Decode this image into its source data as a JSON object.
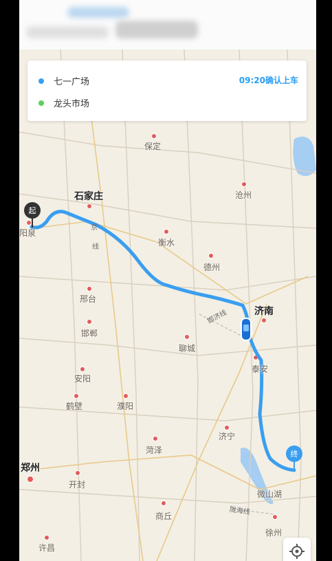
{
  "trip_card": {
    "origin": "七一广场",
    "destination": "龙头市场",
    "pickup_confirm": "09:20确认上车"
  },
  "markers": {
    "start": "起",
    "end": "终"
  },
  "cities": {
    "baoding": "保定",
    "shijiazhuang": "石家庄",
    "cangzhou": "沧州",
    "yangquan": "阳泉",
    "hengshui": "衡水",
    "dezhou": "德州",
    "xingtai": "邢台",
    "jinan": "济南",
    "handan": "邯郸",
    "liaocheng": "聊城",
    "taian": "泰安",
    "anyang": "安阳",
    "hebi": "鹤壁",
    "puyang": "濮阳",
    "jining": "济宁",
    "heze": "菏泽",
    "zhengzhou": "郑州",
    "kaifeng": "开封",
    "weishanhu": "微山湖",
    "shangqiu": "商丘",
    "xuchang": "许昌",
    "xuzhou": "徐州"
  },
  "roads": {
    "jing": "京",
    "xian": "线",
    "hanjiao": "邯济线",
    "longhai": "陇海线"
  },
  "colors": {
    "route": "#3a9ef0",
    "origin_dot": "#3aa0ee",
    "destination_dot": "#5bd15b",
    "confirm_text": "#2a9ef2"
  }
}
